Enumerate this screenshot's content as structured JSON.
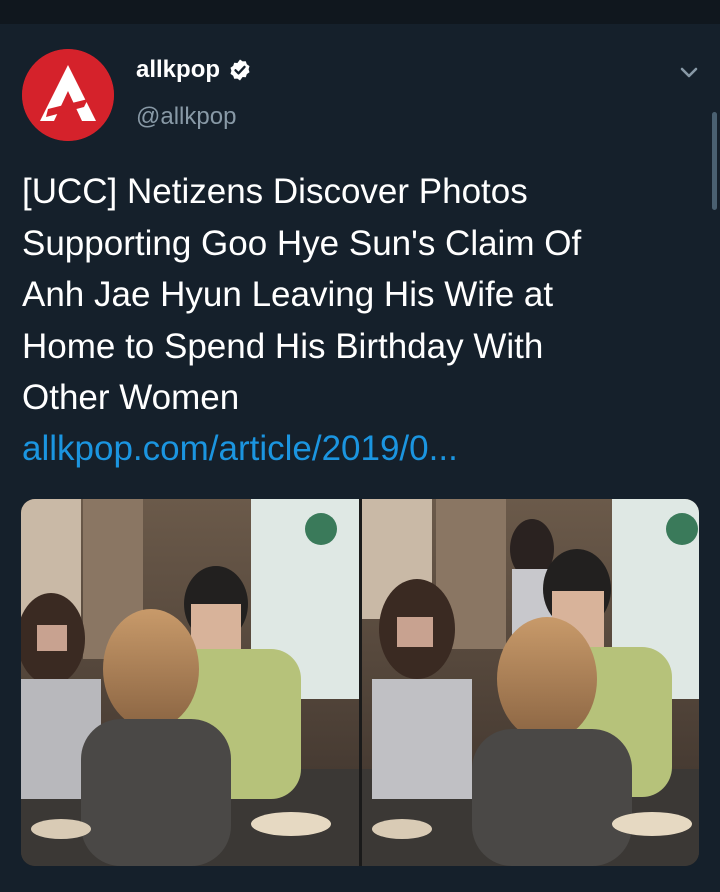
{
  "status_bar": {},
  "account": {
    "name": "allkpop",
    "handle": "@allkpop",
    "verified": true,
    "avatar_icon": "allkpop-logo-icon",
    "avatar_color": "#d5222b"
  },
  "tweet": {
    "lines": [
      "[UCC] Netizens Discover Photos",
      "Supporting Goo Hye Sun's Claim Of",
      "Anh Jae Hyun Leaving His Wife at",
      "Home to Spend His Birthday With",
      "Other Women"
    ],
    "link": "allkpop.com/article/2019/0..."
  },
  "media": {
    "image_count": 2
  },
  "colors": {
    "background": "#15202b",
    "text": "#ffffff",
    "secondary_text": "#8899a6",
    "link": "#1b95e0"
  },
  "icons": {
    "more": "chevron-down-icon",
    "verified": "verified-badge-icon"
  }
}
